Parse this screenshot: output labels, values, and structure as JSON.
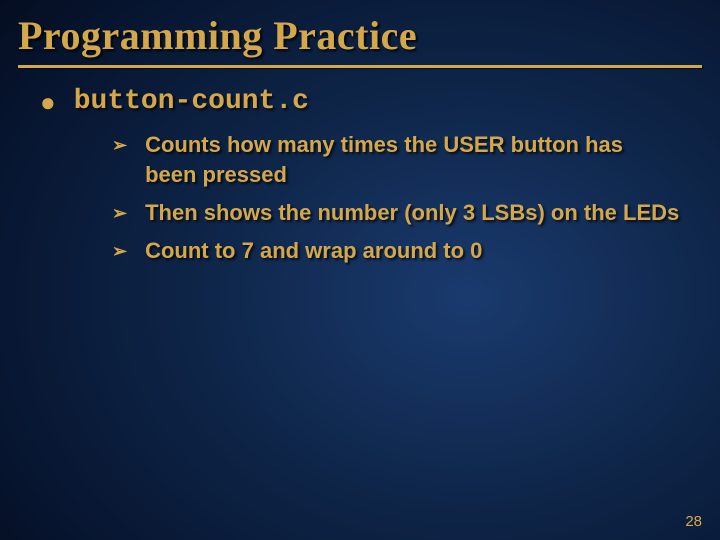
{
  "title": "Programming Practice",
  "main_bullet": "button-count.c",
  "sub_items": [
    "Counts how many times the USER button has been pressed",
    "Then shows the number (only 3 LSBs) on the LEDs",
    "Count to 7 and wrap around to 0"
  ],
  "page_number": "28"
}
